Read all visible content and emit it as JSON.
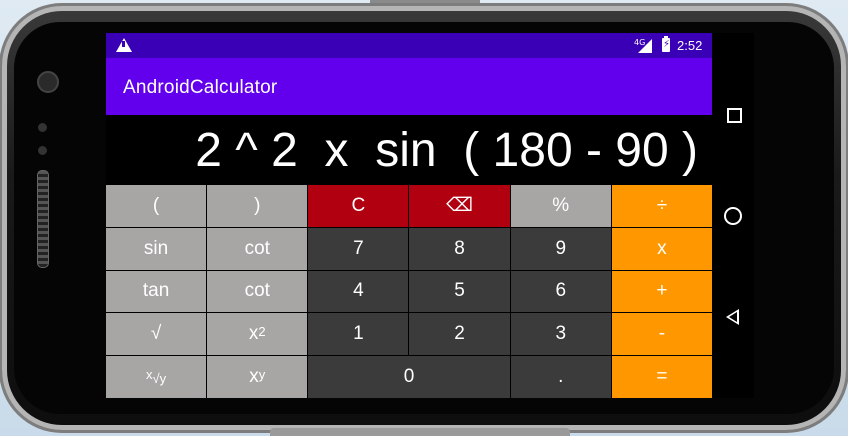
{
  "status_bar": {
    "warning_icon": "warning-icon",
    "network_label": "4G",
    "time": "2:52"
  },
  "app_bar": {
    "title": "AndroidCalculator"
  },
  "display": {
    "expression": "2 ^ 2  x  sin  ( 180 - 90 )"
  },
  "keys": {
    "row1": [
      "(",
      ")",
      "C",
      "⌫",
      "%",
      "÷"
    ],
    "row2": [
      "sin",
      "cot",
      "7",
      "8",
      "9",
      "x"
    ],
    "row3": [
      "tan",
      "cot",
      "4",
      "5",
      "6",
      "+"
    ],
    "row4": [
      "√",
      "x",
      "2",
      "1",
      "2",
      "3",
      "-"
    ],
    "row5": {
      "root_base": "x",
      "root_sign": "√y",
      "power_base": "x",
      "power_exp": "y",
      "zero": "0",
      "dot": ".",
      "equals": "="
    }
  },
  "colors": {
    "status_bar": "#3a00b5",
    "app_bar": "#6200ee",
    "function_key": "#a8a5a5",
    "number_key": "#3b3b3b",
    "operator_key": "#ff9800",
    "clear_key": "#b1000f"
  }
}
